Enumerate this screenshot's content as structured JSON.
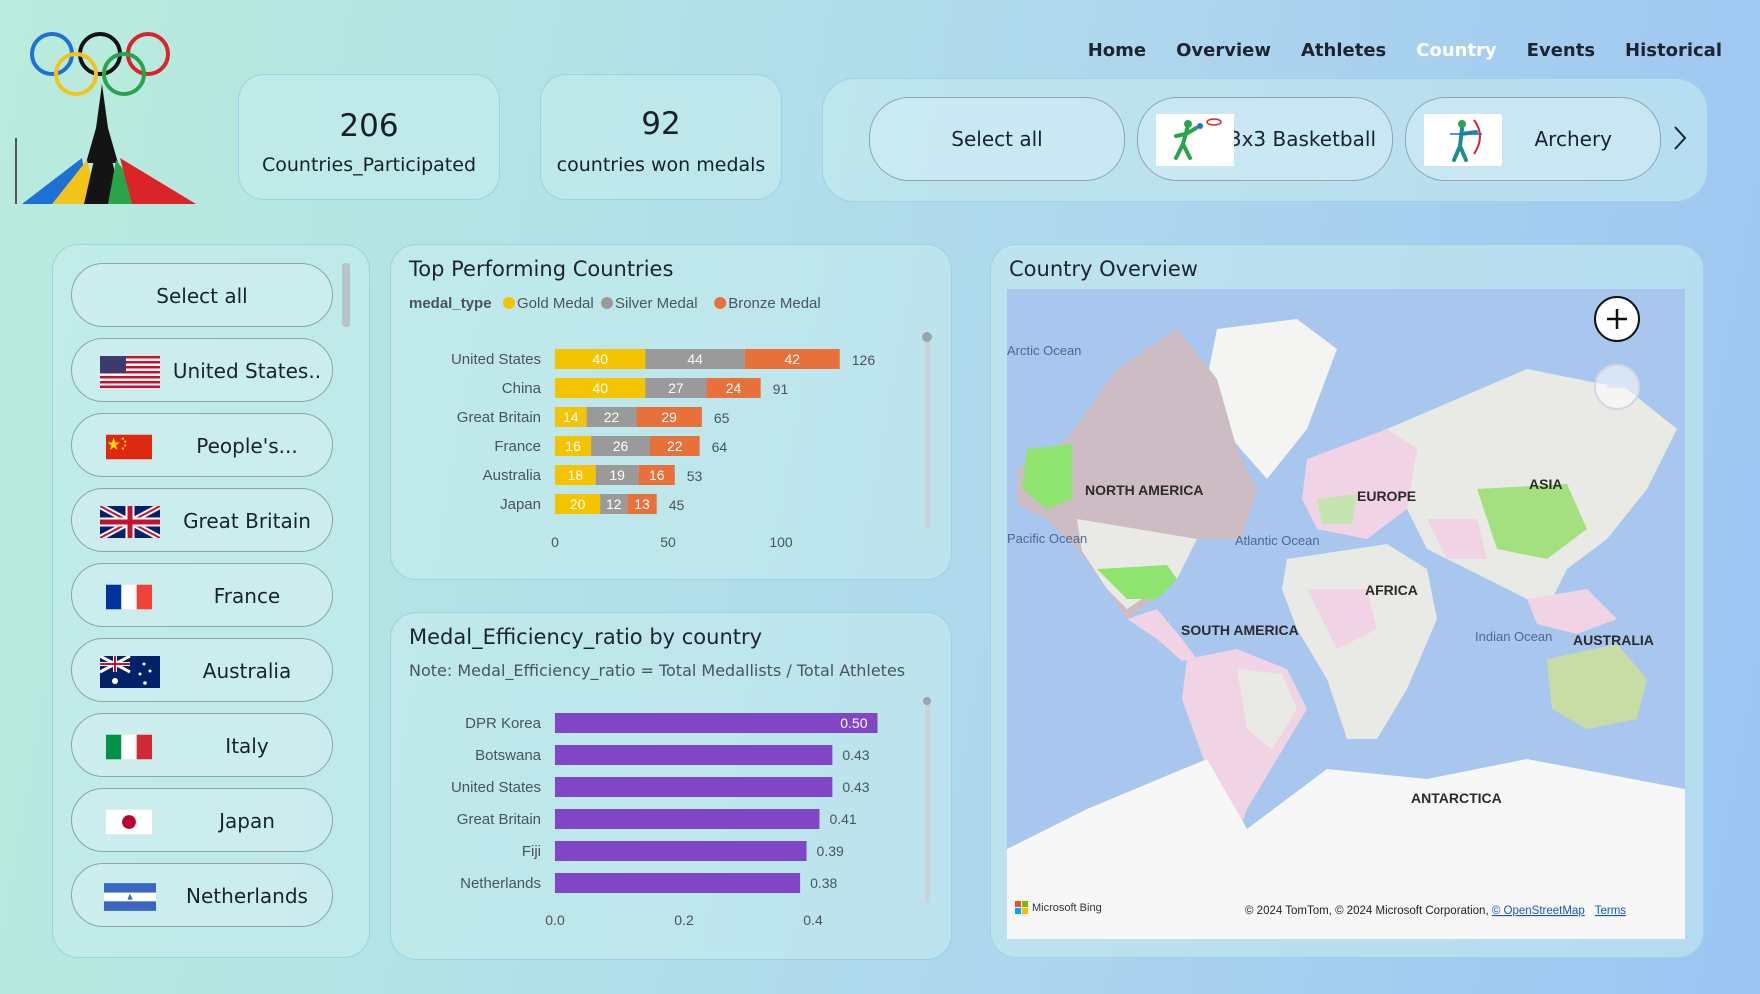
{
  "nav": [
    "Home",
    "Overview",
    "Athletes",
    "Country",
    "Events",
    "Historical"
  ],
  "nav_active": "Country",
  "kpis": [
    {
      "value": "206",
      "label": "Countries_Participated"
    },
    {
      "value": "92",
      "label": "countries won medals"
    }
  ],
  "sport_slicer": {
    "items": [
      {
        "label": "Select all",
        "icon": ""
      },
      {
        "label": "3x3 Basketball",
        "icon": "basketball-player-icon"
      },
      {
        "label": "Archery",
        "icon": "archer-icon"
      }
    ],
    "next_icon": "chevron-right-icon"
  },
  "country_slicer": {
    "select_all": "Select all",
    "items": [
      {
        "name": "United States..",
        "flag": "us-flag-icon"
      },
      {
        "name": "People's...",
        "flag": "china-flag-icon"
      },
      {
        "name": "Great Britain",
        "flag": "uk-flag-icon"
      },
      {
        "name": "France",
        "flag": "france-flag-icon"
      },
      {
        "name": "Australia",
        "flag": "australia-flag-icon"
      },
      {
        "name": "Italy",
        "flag": "italy-flag-icon"
      },
      {
        "name": "Japan",
        "flag": "japan-flag-icon"
      },
      {
        "name": "Netherlands",
        "flag": "netherlands-flag-icon"
      }
    ]
  },
  "top_countries": {
    "title": "Top Performing Countries",
    "legend_title": "medal_type",
    "colors": {
      "gold": "#f5c400",
      "silver": "#9a9a9a",
      "bronze": "#e8703a"
    }
  },
  "efficiency": {
    "title": "Medal_Efficiency_ratio by country",
    "note": "Note:  Medal_Efficiency_ratio = Total Medallists / Total Athletes",
    "color": "#8146c8"
  },
  "map": {
    "title": "Country Overview",
    "labels": {
      "arctic": "Arctic Ocean",
      "pacific": "Pacific Ocean",
      "na": "NORTH AMERICA",
      "europe": "EUROPE",
      "asia": "ASIA",
      "atlantic": "Atlantic Ocean",
      "africa": "AFRICA",
      "sa": "SOUTH AMERICA",
      "indian": "Indian Ocean",
      "australia": "AUSTRALIA",
      "antarctica": "ANTARCTICA"
    },
    "bing": "Microsoft Bing",
    "copyright": "© 2024 TomTom, © 2024 Microsoft Corporation, ",
    "osm": "© OpenStreetMap",
    "terms": "Terms",
    "zoom_in_icon": "plus-icon",
    "zoom_out_icon": "minus-icon"
  },
  "chart_data": [
    {
      "type": "bar",
      "orientation": "horizontal",
      "stacked": true,
      "title": "Top Performing Countries",
      "legend_title": "medal_type",
      "categories": [
        "United States",
        "China",
        "Great Britain",
        "France",
        "Australia",
        "Japan"
      ],
      "series": [
        {
          "name": "Gold Medal",
          "values": [
            40,
            40,
            14,
            16,
            18,
            20
          ]
        },
        {
          "name": "Silver Medal",
          "values": [
            44,
            27,
            22,
            26,
            19,
            12
          ]
        },
        {
          "name": "Bronze Medal",
          "values": [
            42,
            24,
            29,
            22,
            16,
            13
          ]
        }
      ],
      "totals": [
        126,
        91,
        65,
        64,
        53,
        45
      ],
      "xticks": [
        "0",
        "50",
        "100"
      ],
      "xlim": [
        0,
        140
      ],
      "legend_position": "top-left"
    },
    {
      "type": "bar",
      "orientation": "horizontal",
      "title": "Medal_Efficiency_ratio by country",
      "categories": [
        "DPR Korea",
        "Botswana",
        "United States",
        "Great Britain",
        "Fiji",
        "Netherlands"
      ],
      "values": [
        0.5,
        0.43,
        0.43,
        0.41,
        0.39,
        0.38
      ],
      "value_labels": [
        "0.50",
        "0.43",
        "0.43",
        "0.41",
        "0.39",
        "0.38"
      ],
      "xticks": [
        "0.0",
        "0.2",
        "0.4"
      ],
      "xlim": [
        0,
        0.6
      ]
    }
  ]
}
